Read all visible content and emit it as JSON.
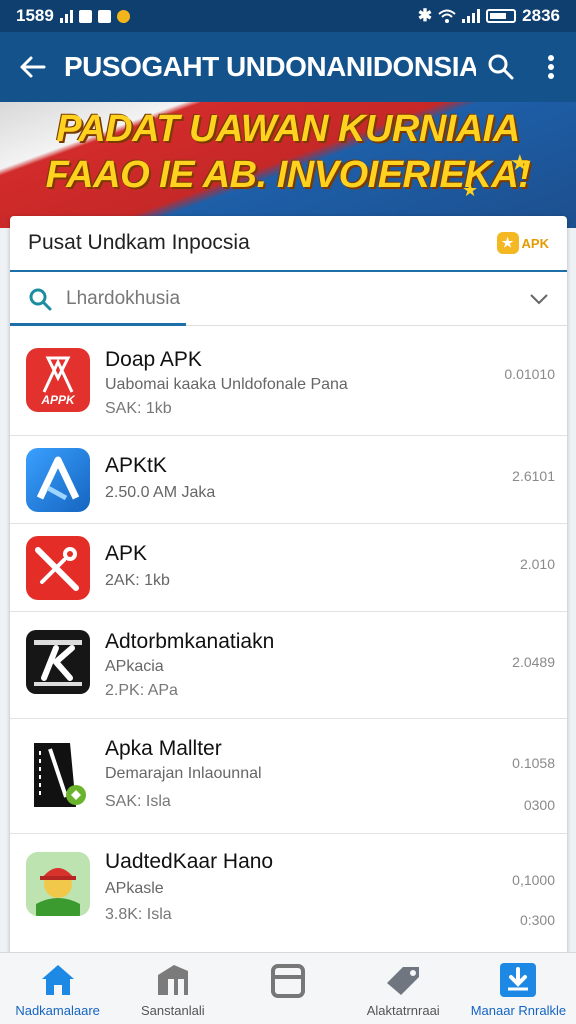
{
  "status_bar": {
    "time": "1589",
    "clock": "2836"
  },
  "app_bar": {
    "title": "PUSOGAHT UNDONANIDONSIA"
  },
  "banner": {
    "line1": "PADAT UAWAN KURNIAIA",
    "line2": "FAAO IE AB. INVOIERIEKA!"
  },
  "card": {
    "title": "Pusat Undkam Inpocsia",
    "badge": "APK",
    "search": {
      "value": "Lhardokhusia"
    }
  },
  "apps": [
    {
      "name": "Doap APK",
      "desc": "Uabomai kaaka Unldofonale Pana",
      "size": "SAK: 1kb",
      "meta": "0.01010",
      "meta2": "",
      "icon": "apk-red-icon",
      "icon_text": "APPK"
    },
    {
      "name": "APKtK",
      "desc": "2.50.0 AM Jaka",
      "size": "",
      "meta": "2.6101",
      "meta2": "",
      "icon": "blue-a-icon",
      "icon_text": ""
    },
    {
      "name": "APK",
      "desc": "2AK: 1kb",
      "size": "",
      "meta": "2.010",
      "meta2": "",
      "icon": "red-wrench-icon",
      "icon_text": ""
    },
    {
      "name": "Adtorbmkanatiakn",
      "desc": "APkacia",
      "size": "2.PK: APa",
      "meta": "2.0489",
      "meta2": "",
      "icon": "dark-kr-icon",
      "icon_text": ""
    },
    {
      "name": "Apka Mallter",
      "desc": "Demarajan Inlaounnal",
      "size": "SAK: Isla",
      "meta": "0.1058",
      "meta2": "0300",
      "icon": "black-flag-icon",
      "icon_text": ""
    },
    {
      "name": "UadtedKaar Hano",
      "desc": "APkasle",
      "size": "3.8K: Isla",
      "meta": "0,1000",
      "meta2": "0:300",
      "icon": "helmet-man-icon",
      "icon_text": ""
    }
  ],
  "nav": [
    {
      "label": "Nadkamalaare",
      "icon": "home-icon"
    },
    {
      "label": "Sanstanlali",
      "icon": "store-icon"
    },
    {
      "label": "",
      "icon": "window-icon"
    },
    {
      "label": "Alaktatrnraai",
      "icon": "tag-icon"
    },
    {
      "label": "Manaar Rnralkle",
      "icon": "download-icon"
    }
  ],
  "colors": {
    "app_bar": "#14528c",
    "accent": "#1d6fa8",
    "banner_text": "#ffd21f",
    "badge": "#e39b00"
  }
}
